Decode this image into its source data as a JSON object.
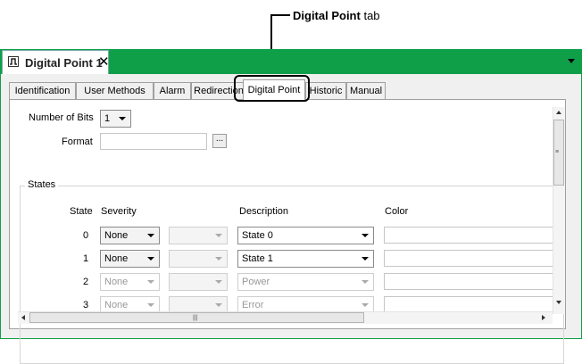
{
  "callout": {
    "bold": "Digital Point",
    "rest": " tab"
  },
  "document_tab": {
    "title": "Digital Point 1",
    "close_label": "✕",
    "icon": "digital-point-icon"
  },
  "tabs": [
    {
      "label": "Identification"
    },
    {
      "label": "User Methods"
    },
    {
      "label": "Alarm"
    },
    {
      "label": "Redirection"
    },
    {
      "label": "Digital Point",
      "active": true
    },
    {
      "label": "Historic"
    },
    {
      "label": "Manual"
    }
  ],
  "form": {
    "number_of_bits_label": "Number of Bits",
    "number_of_bits_value": "1",
    "format_label": "Format",
    "format_value": "",
    "format_button": "..."
  },
  "states": {
    "group_title": "States",
    "headers": {
      "state": "State",
      "severity": "Severity",
      "description": "Description",
      "color": "Color"
    },
    "rows": [
      {
        "state": "0",
        "severity": "None",
        "description": "State 0",
        "enabled": true
      },
      {
        "state": "1",
        "severity": "None",
        "description": "State 1",
        "enabled": true
      },
      {
        "state": "2",
        "severity": "None",
        "description": "Power",
        "enabled": false
      },
      {
        "state": "3",
        "severity": "None",
        "description": "Error",
        "enabled": false
      }
    ]
  },
  "colors": {
    "accent_green": "#0f9f49",
    "panel_bg": "#f0f0f0"
  }
}
